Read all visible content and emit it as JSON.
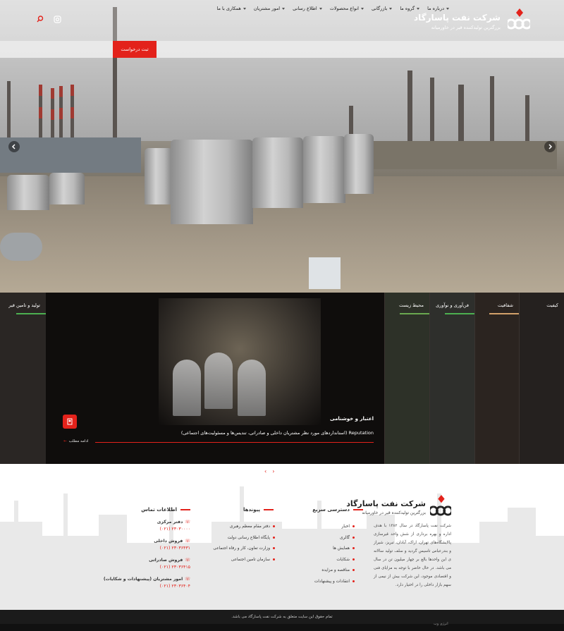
{
  "header": {
    "brand_title": "شرکت نفت پاسارگاد",
    "brand_subtitle": "بزرگترین تولیدکننده قیر در خاورمیانه",
    "request_button": "ثبت درخواست"
  },
  "nav": {
    "items": [
      "درباره ما",
      "گروه ما",
      "بازرگانی",
      "انواع محصولات",
      "اطلاع رسانی",
      "امور مشتریان",
      "همکاری با ما"
    ]
  },
  "values": {
    "tabs": [
      "کیفیت",
      "شفافیت",
      "فن‌آوری و نوآوری",
      "محیط زیست"
    ],
    "left_tab": "تولید و تامین قیر",
    "active": {
      "title": "اعتبار و خوشنامی",
      "description": "Reputation (استانداردهای مورد نظر مشتریان داخلی و صادراتی، تندیس‌ها و مسئولیت‌های اجتماعی)",
      "more": "ادامه مطلب"
    }
  },
  "footer": {
    "brand_title": "شرکت نفت پاسارگاد",
    "brand_subtitle": "بزرگترین تولیدکننده قیر در خاورمیانه",
    "about": "شرکت نفت پاسارگاد در سال ۱۳۸۲ با هدف اداره و بهره برداری از شش واحد قیرسازی پالایشگاه‌های تهران، اراک، آبادان، تبریز، شیراز و بندرعباس تاسیس گردید و سلف تولید سالانه ی این واحدها بالغ بر چهار میلیون تن در سال می باشد. در حال حاضر با توجه به مزایای فنی و اقتصادی موجود، این شرکت بیش از نیمی از سهم بازار داخلی را در اختیار دارد.",
    "quick_access": {
      "title": "دسترسی سریع",
      "items": [
        "اخبار",
        "گالری",
        "همایش ها",
        "شکایات",
        "مناقصه و مزایده",
        "انتقادات و پیشنهادات"
      ]
    },
    "links": {
      "title": "پیوندها",
      "items": [
        "دفتر مقام معظم رهبری",
        "پایگاه اطلاع رسانی دولت",
        "وزارت تعاون، کار و رفاه اجتماعی",
        "سازمان تامین اجتماعی"
      ]
    },
    "contact": {
      "title": "اطلاعات تماس",
      "items": [
        {
          "label": "دفتر مرکزی",
          "phone": "(۰۲۱) ۲۳۰۳۰۰۰۰"
        },
        {
          "label": "فروش داخلی",
          "phone": "(۰۲۱) ۲۳۰۳۶۴۳۱"
        },
        {
          "label": "فروش صادراتی",
          "phone": "(۰۲۱) ۲۳۰۳۶۴۱۵"
        },
        {
          "label": "امور مشتریان (پیشنهادات و شکایات)",
          "phone": "(۰۲۱) ۲۳۰۳۶۴۰۴"
        }
      ]
    },
    "copyright": "تمام حقوق این سایت متعلق به شرکت نفت پاسارگاد می باشد.",
    "credit": "انرژی وب"
  },
  "colors": {
    "accent": "#e3221b"
  }
}
